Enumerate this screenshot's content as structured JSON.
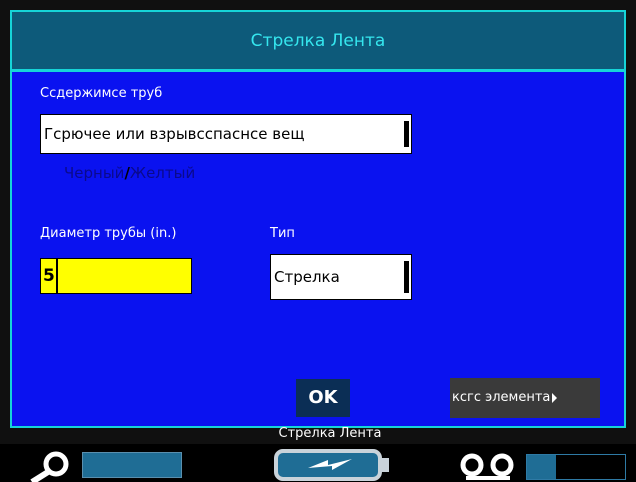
{
  "dialog": {
    "title": "Стрелка Лента",
    "contents_label": "Ссдержимсе труб",
    "contents_value": "Гсрючее или взрывсспаснсе вещ",
    "color_left": "Черный",
    "color_sep": "/",
    "color_right": "Желтый",
    "diameter_label": "Диаметр трубы (in.)",
    "diameter_value": "5",
    "type_label": "Тип",
    "type_value": "Стрелка",
    "ok_label": "OK",
    "next_element_label": "ксгс элемента"
  },
  "status": {
    "label": "Стрелка Лента",
    "tape_remaining_fraction": 0.3
  },
  "colors": {
    "screen_bg": "#0a12f0",
    "title_bg": "#0d5a7a",
    "accent": "#16d4d8",
    "input_highlight": "#ffff00"
  },
  "icons": [
    "zoom-icon",
    "battery-charging-icon",
    "tape-cassette-icon"
  ]
}
